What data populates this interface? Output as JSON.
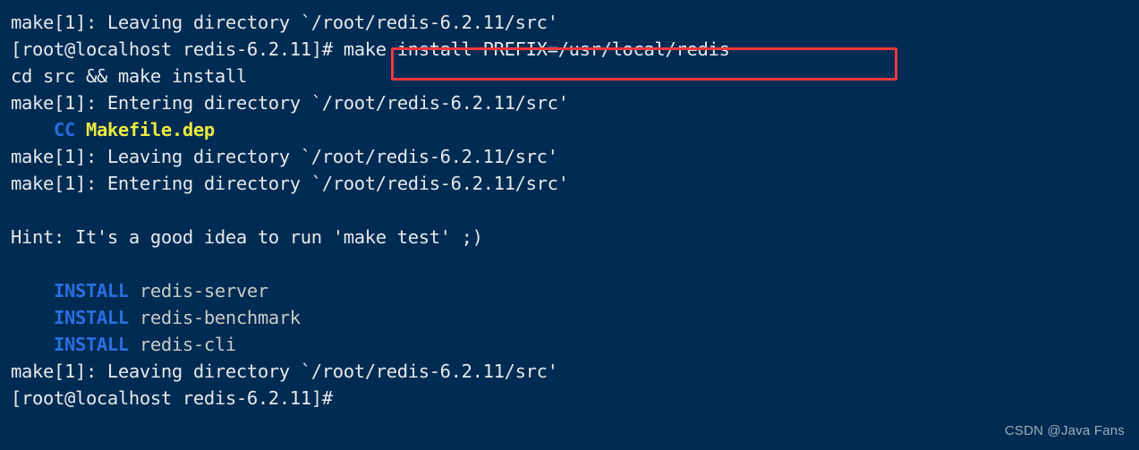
{
  "terminal": {
    "background_color": "#002b52",
    "foreground_color": "#e6e9ec",
    "accent_blue": "#2a6fe0",
    "accent_yellow": "#ece93f",
    "highlight_border_color": "#f5383c",
    "prompt": "[root@localhost redis-6.2.11]#",
    "lines": [
      {
        "text": "make[1]: Leaving directory `/root/redis-6.2.11/src'"
      },
      {
        "text": "[root@localhost redis-6.2.11]# make install PREFIX=/usr/local/redis"
      },
      {
        "text": "cd src && make install"
      },
      {
        "text": "make[1]: Entering directory `/root/redis-6.2.11/src'"
      },
      {
        "text": "    CC Makefile.dep"
      },
      {
        "text": "make[1]: Leaving directory `/root/redis-6.2.11/src'"
      },
      {
        "text": "make[1]: Entering directory `/root/redis-6.2.11/src'"
      },
      {
        "text": ""
      },
      {
        "text": "Hint: It's a good idea to run 'make test' ;)"
      },
      {
        "text": ""
      },
      {
        "text": "    INSTALL redis-server"
      },
      {
        "text": "    INSTALL redis-benchmark"
      },
      {
        "text": "    INSTALL redis-cli"
      },
      {
        "text": "make[1]: Leaving directory `/root/redis-6.2.11/src'"
      },
      {
        "text": "[root@localhost redis-6.2.11]#"
      }
    ],
    "segments": {
      "line_0": [
        {
          "t": "make[1]: Leaving directory `/root/redis-6.2.11/src'",
          "c": "default"
        }
      ],
      "line_1": [
        {
          "t": "[root@localhost redis-6.2.11]# ",
          "c": "default"
        },
        {
          "t": "make install PREFIX=/usr/local/redis",
          "c": "default"
        }
      ],
      "line_2": [
        {
          "t": "cd src && make install",
          "c": "default"
        }
      ],
      "line_3": [
        {
          "t": "make[1]: Entering directory `/root/redis-6.2.11/src'",
          "c": "default"
        }
      ],
      "line_4": [
        {
          "t": "    ",
          "c": "default"
        },
        {
          "t": "CC",
          "c": "blue"
        },
        {
          "t": " ",
          "c": "default"
        },
        {
          "t": "Makefile.dep",
          "c": "yellow"
        }
      ],
      "line_5": [
        {
          "t": "make[1]: Leaving directory `/root/redis-6.2.11/src'",
          "c": "default"
        }
      ],
      "line_6": [
        {
          "t": "make[1]: Entering directory `/root/redis-6.2.11/src'",
          "c": "default"
        }
      ],
      "line_7": [],
      "line_8": [
        {
          "t": "Hint: It's a good idea to run 'make test' ;)",
          "c": "default"
        }
      ],
      "line_9": [],
      "line_10": [
        {
          "t": "    ",
          "c": "default"
        },
        {
          "t": "INSTALL",
          "c": "blue"
        },
        {
          "t": " ",
          "c": "default"
        },
        {
          "t": "redis-server",
          "c": "gray"
        }
      ],
      "line_11": [
        {
          "t": "    ",
          "c": "default"
        },
        {
          "t": "INSTALL",
          "c": "blue"
        },
        {
          "t": " ",
          "c": "default"
        },
        {
          "t": "redis-benchmark",
          "c": "gray"
        }
      ],
      "line_12": [
        {
          "t": "    ",
          "c": "default"
        },
        {
          "t": "INSTALL",
          "c": "blue"
        },
        {
          "t": " ",
          "c": "default"
        },
        {
          "t": "redis-cli",
          "c": "gray"
        }
      ],
      "line_13": [
        {
          "t": "make[1]: Leaving directory `/root/redis-6.2.11/src'",
          "c": "default"
        }
      ],
      "line_14": [
        {
          "t": "[root@localhost redis-6.2.11]#",
          "c": "default"
        }
      ]
    },
    "highlighted_command": "make install PREFIX=/usr/local/redis"
  },
  "watermark": {
    "text": "CSDN @Java Fans"
  }
}
